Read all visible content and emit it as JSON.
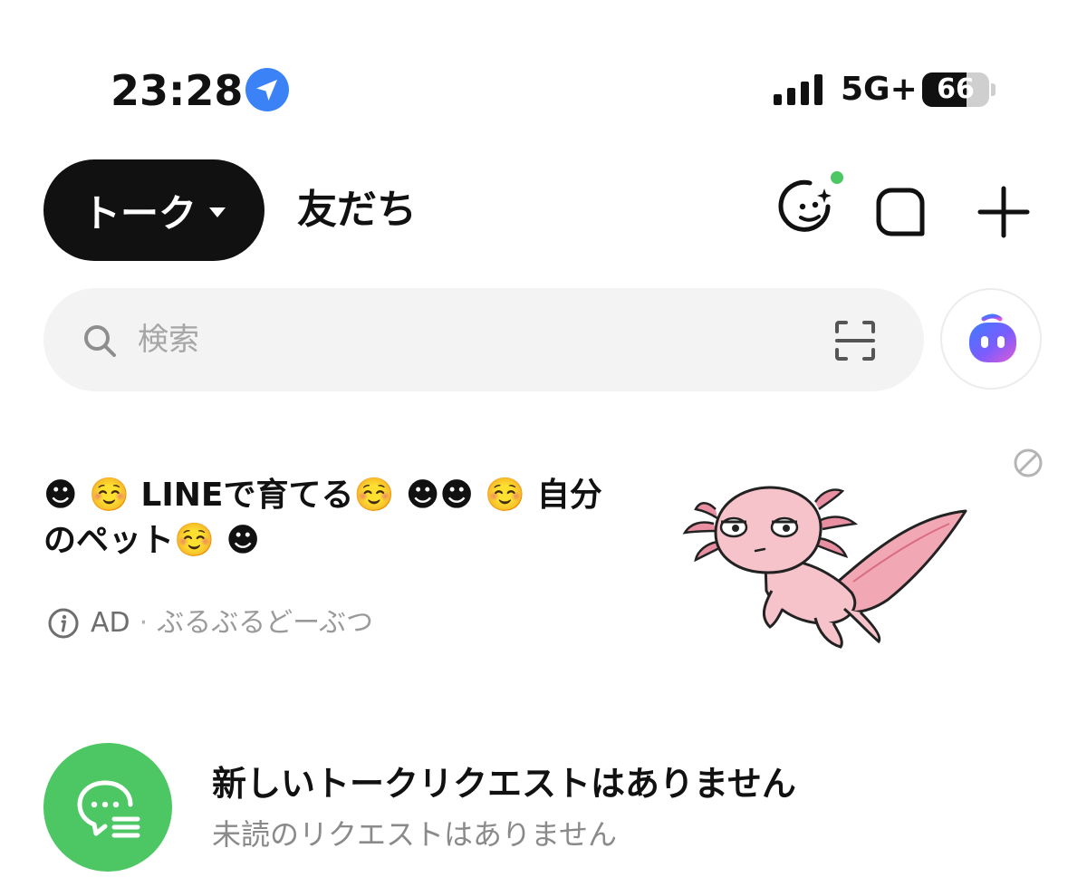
{
  "status_bar": {
    "time": "23:28",
    "network": "5G+",
    "battery": "66",
    "battery_level": 0.66,
    "location_icon": "location-arrow-icon",
    "signal_icon": "signal-bars-icon"
  },
  "header": {
    "active_tab": "トーク",
    "other_tab": "友だち",
    "icons": [
      "face-sparkle-icon",
      "square-icon",
      "plus-icon"
    ],
    "notification_dot_color": "#4cc764"
  },
  "search": {
    "placeholder": "検索",
    "icon": "search-icon",
    "scan_icon": "scan-icon",
    "ai_icon": "ai-assistant-icon"
  },
  "ad": {
    "title": "☻ ☺️ LINEで育てる☺️ ☻☻ ☺️ 自分のペット☺️ ☻",
    "label": "AD",
    "separator": "·",
    "sponsor": "ぶるぶるどーぶつ",
    "image": "axolotl-illustration"
  },
  "talk_request": {
    "title": "新しいトークリクエストはありません",
    "subtitle": "未読のリクエストはありません",
    "icon_color": "#4cc764"
  }
}
